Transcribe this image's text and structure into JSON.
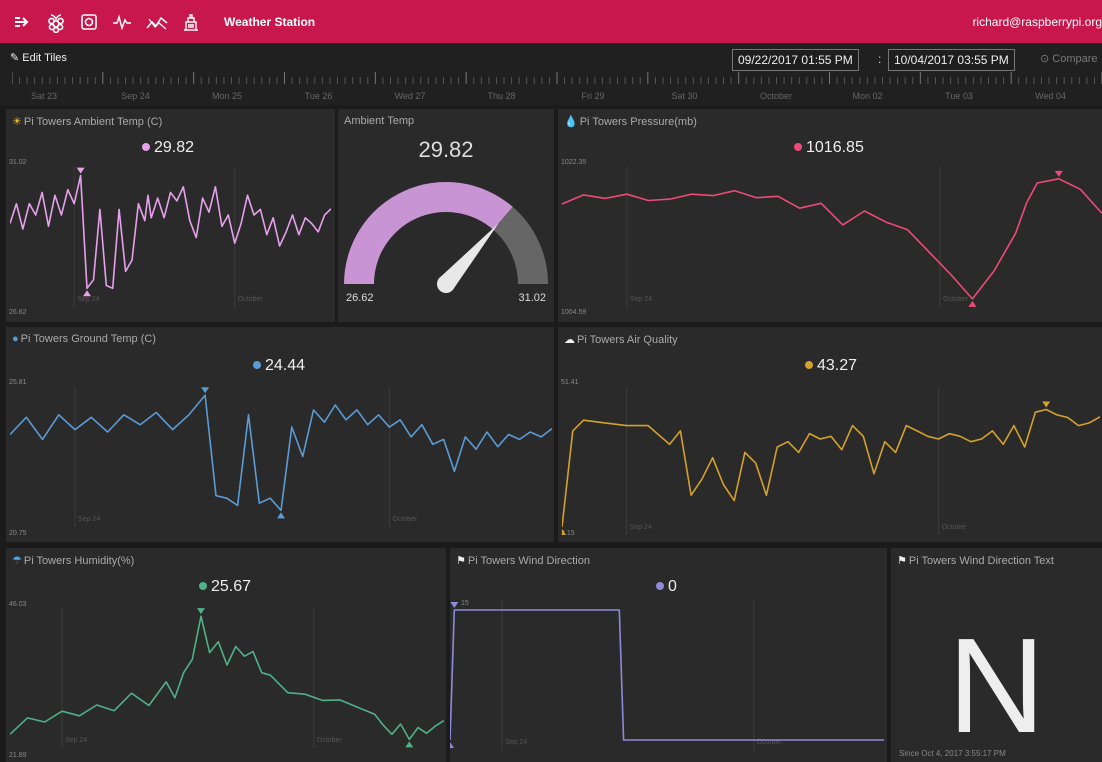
{
  "topbar": {
    "title": "Weather Station",
    "user": "richard@raspberrypi.org",
    "icons": [
      "menu-arrow-icon",
      "raspberry-icon",
      "camera-icon",
      "pulse-icon",
      "trend-icon",
      "building-icon"
    ]
  },
  "timebar": {
    "edit_label": "Edit Tiles",
    "start": "09/22/2017 01:55 PM",
    "separator": ":",
    "end": "10/04/2017 03:55 PM",
    "compare_label": "Compare",
    "labels": [
      "Sat 23",
      "Sep 24",
      "Mon 25",
      "Tue 26",
      "Wed 27",
      "Thu 28",
      "Fri 29",
      "Sat 30",
      "October",
      "Mon 02",
      "Tue 03",
      "Wed 04"
    ]
  },
  "tiles": {
    "ambient": {
      "title": "Pi Towers Ambient Temp (C)",
      "icon": "sun-icon",
      "current": "29.82",
      "ymax": "31.02",
      "ymin": "26.62",
      "color": "#e7a0ec",
      "chart_data": {
        "type": "line",
        "x": [
          0,
          2,
          4,
          6,
          8,
          10,
          12,
          14,
          16,
          18,
          20,
          22,
          24,
          26,
          28,
          30,
          32,
          34,
          36,
          38,
          40,
          42,
          43,
          44,
          46,
          48,
          50,
          52,
          54,
          56,
          58,
          60,
          62,
          64,
          66,
          68,
          70,
          72,
          74,
          76,
          78,
          80,
          82,
          84,
          86,
          88,
          90,
          92,
          94,
          96,
          98,
          100
        ],
        "y": [
          29.3,
          30.0,
          29.1,
          30.0,
          29.6,
          30.4,
          29.2,
          30.3,
          29.6,
          30.5,
          30.0,
          31.0,
          27.0,
          27.3,
          29.8,
          27.1,
          27.0,
          29.8,
          27.6,
          28.0,
          30.0,
          29.4,
          30.3,
          29.5,
          30.2,
          29.5,
          30.4,
          30.1,
          30.6,
          29.4,
          28.8,
          30.2,
          29.7,
          30.6,
          29.2,
          29.6,
          28.6,
          29.3,
          30.3,
          29.6,
          29.8,
          28.9,
          29.5,
          28.5,
          29.0,
          29.6,
          28.9,
          29.5,
          29.3,
          29.0,
          29.6,
          29.82
        ],
        "ylim": [
          26.62,
          31.02
        ]
      }
    },
    "gauge": {
      "title": "Ambient Temp",
      "value": "29.82",
      "min": "26.62",
      "max": "31.02",
      "fill_color": "#c994d4",
      "rest_color": "#666666"
    },
    "pressure": {
      "title": "Pi Towers Pressure(mb)",
      "icon": "drop-icon",
      "current": "1016.85",
      "ymax": "1022.35",
      "ymin": "1004.59",
      "color": "#ec4a7a",
      "chart_data": {
        "type": "line",
        "x": [
          0,
          4,
          8,
          12,
          16,
          20,
          24,
          28,
          32,
          36,
          40,
          44,
          48,
          52,
          56,
          60,
          64,
          68,
          72,
          76,
          80,
          84,
          86,
          88,
          92,
          96,
          100
        ],
        "y": [
          1018.2,
          1019.5,
          1019.0,
          1019.6,
          1018.7,
          1018.9,
          1019.6,
          1019.4,
          1020.1,
          1019.1,
          1019.3,
          1017.6,
          1018.3,
          1015.2,
          1017.2,
          1015.6,
          1014.5,
          1011.3,
          1008.1,
          1004.6,
          1008.6,
          1014.0,
          1018.3,
          1021.2,
          1021.8,
          1020.3,
          1016.85
        ],
        "ylim": [
          1004.59,
          1022.35
        ]
      }
    },
    "ground": {
      "title": "Pi Towers Ground Temp (C)",
      "icon": "globe-icon",
      "current": "24.44",
      "ymax": "25.81",
      "ymin": "20.75",
      "color": "#5b9bd5",
      "chart_data": {
        "type": "line",
        "x": [
          0,
          3,
          6,
          9,
          12,
          15,
          18,
          21,
          24,
          27,
          30,
          33,
          36,
          38,
          40,
          42,
          44,
          46,
          48,
          50,
          52,
          54,
          56,
          58,
          60,
          62,
          64,
          66,
          68,
          70,
          72,
          74,
          76,
          78,
          80,
          82,
          84,
          86,
          88,
          90,
          92,
          94,
          96,
          98,
          100
        ],
        "y": [
          24.2,
          24.9,
          24.0,
          25.0,
          24.4,
          24.9,
          24.3,
          25.0,
          24.6,
          25.1,
          24.4,
          25.0,
          25.8,
          21.7,
          21.6,
          21.3,
          25.0,
          21.4,
          21.6,
          21.1,
          24.5,
          23.3,
          25.2,
          24.7,
          25.4,
          24.8,
          25.2,
          24.6,
          25.0,
          24.5,
          24.8,
          24.1,
          24.6,
          23.8,
          24.0,
          22.7,
          24.1,
          23.6,
          24.3,
          23.7,
          24.2,
          24.0,
          24.3,
          24.1,
          24.44
        ],
        "ylim": [
          20.75,
          25.81
        ]
      }
    },
    "air": {
      "title": "Pi Towers Air Quality",
      "icon": "cloud-icon",
      "current": "43.27",
      "ymax": "51.41",
      "ymin": "2.15",
      "color": "#d4a22c",
      "chart_data": {
        "type": "line",
        "x": [
          0,
          2,
          4,
          8,
          12,
          16,
          20,
          22,
          24,
          26,
          28,
          30,
          32,
          34,
          36,
          38,
          40,
          42,
          44,
          46,
          48,
          50,
          52,
          54,
          56,
          58,
          60,
          62,
          64,
          66,
          68,
          70,
          72,
          74,
          76,
          78,
          80,
          82,
          84,
          86,
          88,
          90,
          92,
          94,
          96,
          98,
          100
        ],
        "y": [
          2.2,
          38,
          42,
          41,
          40,
          40,
          33,
          38,
          14,
          20,
          28,
          18,
          12,
          30,
          26,
          14,
          32,
          34,
          30,
          37,
          35,
          36,
          31,
          40,
          36,
          22,
          34,
          30,
          40,
          38,
          36,
          35,
          37,
          36,
          34,
          35,
          38,
          33,
          40,
          32,
          45,
          46,
          44,
          43,
          40,
          41,
          43.27
        ],
        "ylim": [
          2.15,
          51.41
        ]
      }
    },
    "humidity": {
      "title": "Pi Towers Humidity(%)",
      "icon": "rain-icon",
      "current": "25.67",
      "ymax": "46.03",
      "ymin": "21.89",
      "color": "#4fb08a",
      "chart_data": {
        "type": "line",
        "x": [
          0,
          4,
          8,
          12,
          16,
          20,
          24,
          28,
          32,
          36,
          38,
          40,
          42,
          44,
          46,
          48,
          50,
          52,
          54,
          56,
          58,
          60,
          64,
          68,
          72,
          76,
          80,
          84,
          86,
          88,
          90,
          92,
          94,
          96,
          98,
          100
        ],
        "y": [
          23,
          26.2,
          25.4,
          27.5,
          26.6,
          28.7,
          27.6,
          31.0,
          28.6,
          33.2,
          30.1,
          35.0,
          37.6,
          46.0,
          38.9,
          41.0,
          36.5,
          40.1,
          38.2,
          39.1,
          35.0,
          34.5,
          31.1,
          30.8,
          29.6,
          29.7,
          28.3,
          26.9,
          24.8,
          23.0,
          25.0,
          22.0,
          24.3,
          23.2,
          24.6,
          25.67
        ],
        "ylim": [
          21.89,
          46.03
        ]
      }
    },
    "wind": {
      "title": "Pi Towers Wind Direction",
      "icon": "windsock-icon",
      "current": "0",
      "ymax": "15",
      "ymin": "0",
      "color": "#9088d8",
      "chart_data": {
        "type": "line",
        "x": [
          0,
          1,
          39,
          40,
          100
        ],
        "y": [
          0,
          15,
          15,
          0,
          0
        ],
        "ylim": [
          0,
          15
        ]
      }
    },
    "windtext": {
      "title": "Pi Towers Wind Direction Text",
      "icon": "windsock-icon",
      "value": "N",
      "since": "Since Oct 4, 2017 3:55:17 PM"
    }
  },
  "axis_labels": {
    "sep24": "Sep 24",
    "october": "October"
  }
}
